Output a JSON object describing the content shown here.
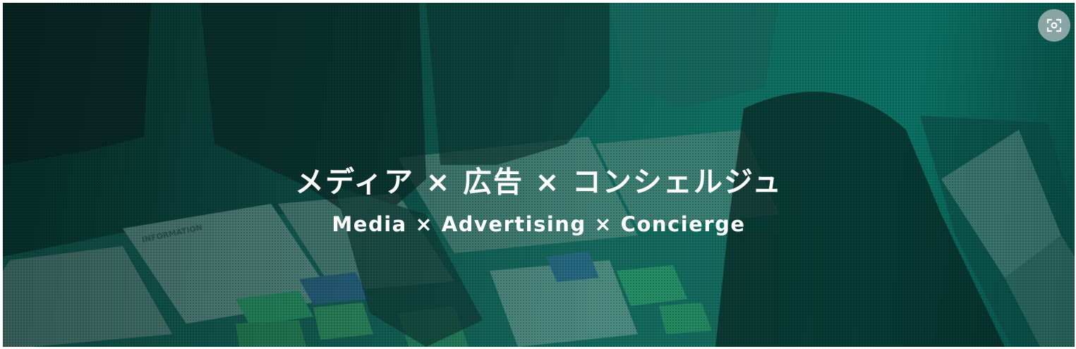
{
  "banner": {
    "title_jp": "メディア × 広告 × コンシェルジュ",
    "title_en": "Media × Advertising × Concierge",
    "overlay_color": "#0f6b60"
  },
  "photo_text": {
    "paper_heading": "INFORMATION"
  },
  "icons": {
    "lens": "visual-search-icon"
  }
}
